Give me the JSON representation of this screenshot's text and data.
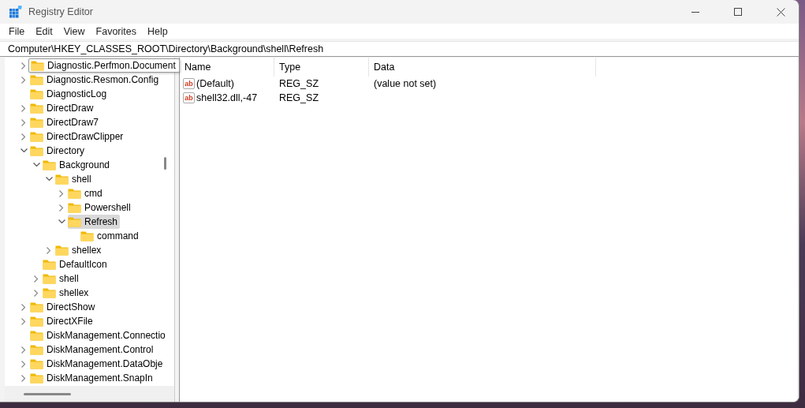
{
  "window": {
    "title": "Registry Editor"
  },
  "menu": [
    "File",
    "Edit",
    "View",
    "Favorites",
    "Help"
  ],
  "address": "Computer\\HKEY_CLASSES_ROOT\\Directory\\Background\\shell\\Refresh",
  "tree": [
    {
      "label": "Diagnostic.Perfmon.Document",
      "expanded": false,
      "selected": false,
      "tooltip": true
    },
    {
      "label": "Diagnostic.Resmon.Config",
      "expanded": false,
      "selected": false
    },
    {
      "label": "DiagnosticLog",
      "selected": false
    },
    {
      "label": "DirectDraw",
      "expanded": false,
      "selected": false
    },
    {
      "label": "DirectDraw7",
      "expanded": false,
      "selected": false
    },
    {
      "label": "DirectDrawClipper",
      "expanded": false,
      "selected": false
    },
    {
      "label": "Directory",
      "expanded": true,
      "selected": false,
      "children": [
        {
          "label": "Background",
          "expanded": true,
          "selected": false,
          "children": [
            {
              "label": "shell",
              "expanded": true,
              "selected": false,
              "children": [
                {
                  "label": "cmd",
                  "expanded": false,
                  "selected": false
                },
                {
                  "label": "Powershell",
                  "expanded": false,
                  "selected": false
                },
                {
                  "label": "Refresh",
                  "expanded": true,
                  "selected": true,
                  "children": [
                    {
                      "label": "command",
                      "selected": false
                    }
                  ]
                }
              ]
            },
            {
              "label": "shellex",
              "expanded": false,
              "selected": false
            }
          ]
        },
        {
          "label": "DefaultIcon",
          "selected": false
        },
        {
          "label": "shell",
          "expanded": false,
          "selected": false
        },
        {
          "label": "shellex",
          "expanded": false,
          "selected": false
        }
      ]
    },
    {
      "label": "DirectShow",
      "expanded": false,
      "selected": false
    },
    {
      "label": "DirectXFile",
      "expanded": false,
      "selected": false
    },
    {
      "label": "DiskManagement.Connectio",
      "selected": false
    },
    {
      "label": "DiskManagement.Control",
      "expanded": false,
      "selected": false
    },
    {
      "label": "DiskManagement.DataObje",
      "expanded": false,
      "selected": false
    },
    {
      "label": "DiskManagement.SnapIn",
      "expanded": false,
      "selected": false
    }
  ],
  "table": {
    "columns": [
      "Name",
      "Type",
      "Data"
    ],
    "rows": [
      {
        "icon": "ab",
        "name": "(Default)",
        "type": "REG_SZ",
        "data": "(value not set)"
      },
      {
        "icon": "ab",
        "name": "shell32.dll,-47",
        "type": "REG_SZ"
      }
    ]
  }
}
